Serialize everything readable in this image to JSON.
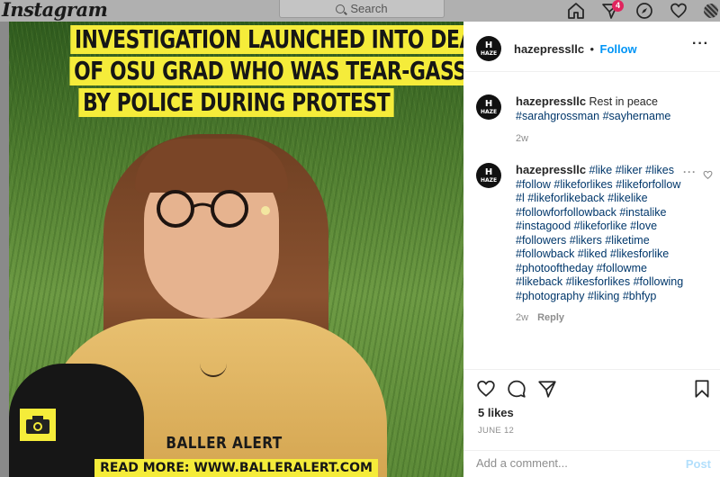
{
  "app": {
    "logo": "Instagram"
  },
  "search": {
    "placeholder": "Search"
  },
  "nav": {
    "activity_badge": "4"
  },
  "post": {
    "headline": [
      "INVESTIGATION LAUNCHED INTO DEATH",
      "OF OSU GRAD WHO WAS TEAR-GASSED",
      "BY POLICE DURING PROTEST"
    ],
    "watermark": "BALLER ALERT",
    "read_more": "READ MORE: WWW.BALLERALERT.COM"
  },
  "header": {
    "username": "hazepressllc",
    "separator": "•",
    "follow_label": "Follow",
    "more": "···"
  },
  "avatar_text": {
    "line1": "H",
    "line2": "HAZE"
  },
  "caption": {
    "username": "hazepressllc",
    "text": "Rest in peace",
    "tags": "#sarahgrossman #sayhername",
    "time": "2w"
  },
  "comment": {
    "username": "hazepressllc",
    "tags": "#like #liker #likes #follow #likeforlikes #likeforfollow #l #likeforlikeback #likelike #followforfollowback #instalike #instagood #likeforlike #love #followers #likers #liketime #followback #liked #likesforlike #photooftheday #followme #likeback #likesforlikes #following #photography #liking #bhfyp",
    "time": "2w",
    "reply": "Reply",
    "more": "···"
  },
  "stats": {
    "likes": "5 likes",
    "date": "JUNE 12"
  },
  "composer": {
    "placeholder": "Add a comment...",
    "post_label": "Post"
  },
  "colors": {
    "accent": "#0095f6",
    "highlight": "#f5ec3a",
    "badge": "#e0245e"
  }
}
